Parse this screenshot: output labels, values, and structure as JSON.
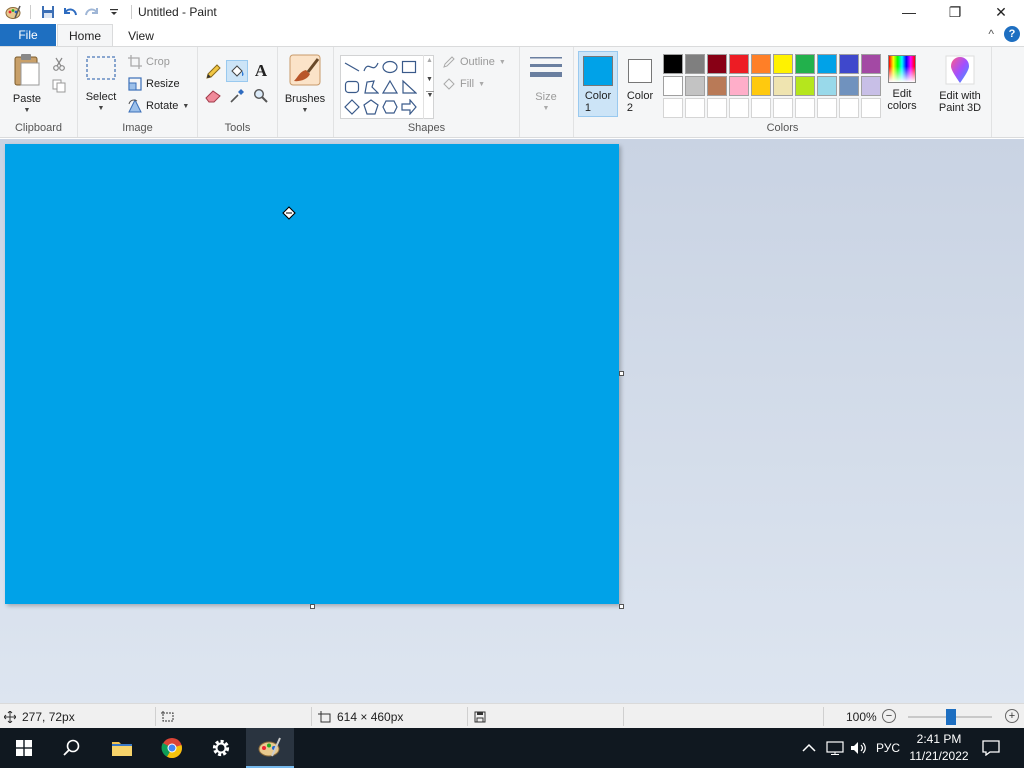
{
  "window": {
    "title": "Untitled - Paint",
    "minimize_glyph": "—",
    "maximize_glyph": "❐",
    "close_glyph": "✕"
  },
  "tabs": {
    "file": "File",
    "home": "Home",
    "view": "View",
    "collapse_glyph": "^",
    "help_glyph": "?"
  },
  "clipboard": {
    "paste": "Paste",
    "label": "Clipboard"
  },
  "image": {
    "select": "Select",
    "crop": "Crop",
    "resize": "Resize",
    "rotate": "Rotate",
    "label": "Image"
  },
  "tools": {
    "label": "Tools",
    "selected_tool": "fill-with-color"
  },
  "brushes": {
    "label": "Brushes"
  },
  "shapes": {
    "outline": "Outline",
    "fill": "Fill",
    "label": "Shapes"
  },
  "size": {
    "label": "Size"
  },
  "colors": {
    "color1_label": "Color\n1",
    "color2_label": "Color\n2",
    "color1": "#00a2e8",
    "color2": "#ffffff",
    "edit_colors": "Edit\ncolors",
    "label": "Colors",
    "palette_row1": [
      "#000000",
      "#7f7f7f",
      "#880015",
      "#ed1c24",
      "#ff7f27",
      "#fff200",
      "#22b14c",
      "#00a2e8",
      "#3f48cc",
      "#a349a4"
    ],
    "palette_row2": [
      "#ffffff",
      "#c3c3c3",
      "#b97a57",
      "#ffaec9",
      "#ffc90e",
      "#efe4b0",
      "#b5e61d",
      "#99d9ea",
      "#7092be",
      "#c8bfe7"
    ]
  },
  "paint3d": {
    "label": "Edit with\nPaint 3D"
  },
  "canvas": {
    "fill": "#00a2e8"
  },
  "status": {
    "cursor_pos": "277, 72px",
    "canvas_size": "614 × 460px",
    "zoom": "100%",
    "zoom_minus": "−",
    "zoom_plus": "+"
  },
  "taskbar": {
    "language": "РУС",
    "time": "2:41 PM",
    "date": "11/21/2022"
  }
}
